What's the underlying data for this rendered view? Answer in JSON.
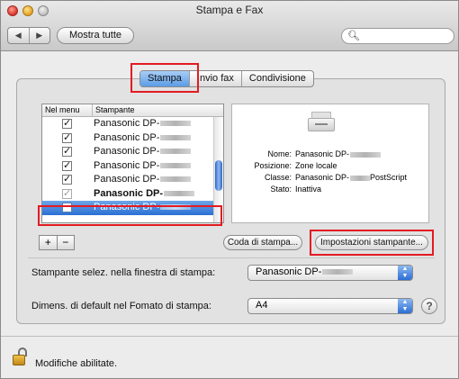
{
  "window": {
    "title": "Stampa e Fax"
  },
  "toolbar": {
    "show_all_label": "Mostra tutte",
    "search_value": ""
  },
  "tabs": [
    {
      "label": "Stampa",
      "active": true
    },
    {
      "label": "Invio fax",
      "active": false
    },
    {
      "label": "Condivisione",
      "active": false
    }
  ],
  "printer_list": {
    "columns": {
      "in_menu": "Nel menu",
      "printer": "Stampante"
    },
    "rows": [
      {
        "name": "Panasonic DP-",
        "checked": true,
        "bold": false,
        "selected": false
      },
      {
        "name": "Panasonic DP-",
        "checked": true,
        "bold": false,
        "selected": false
      },
      {
        "name": "Panasonic DP-",
        "checked": true,
        "bold": false,
        "selected": false
      },
      {
        "name": "Panasonic DP-",
        "checked": true,
        "bold": false,
        "selected": false
      },
      {
        "name": "Panasonic DP-",
        "checked": true,
        "bold": false,
        "selected": false
      },
      {
        "name": "Panasonic DP-",
        "checked": true,
        "bold": true,
        "selected": false
      },
      {
        "name": "Panasonic DP-",
        "checked": false,
        "bold": false,
        "selected": true
      }
    ]
  },
  "printer_info": {
    "name_label": "Nome:",
    "name_value": "Panasonic DP-",
    "location_label": "Posizione:",
    "location_value": "Zone locale",
    "class_label": "Classe:",
    "class_value_prefix": "Panasonic DP-",
    "class_value_suffix": "PostScript",
    "status_label": "Stato:",
    "status_value": "Inattiva"
  },
  "list_controls": {
    "add_label": "+",
    "remove_label": "−"
  },
  "buttons": {
    "queue_label": "Coda di stampa...",
    "settings_label": "Impostazioni stampante..."
  },
  "defaults": {
    "printer_label": "Stampante selez. nella finestra di stampa:",
    "printer_value": "Panasonic DP-",
    "paper_label": "Dimens. di default nel Fomato di stampa:",
    "paper_value": "A4"
  },
  "help": {
    "label": "?"
  },
  "lock": {
    "label": "Modifiche abilitate."
  },
  "colors": {
    "highlight": "#e31b23",
    "selection": "#2a6fd3"
  }
}
